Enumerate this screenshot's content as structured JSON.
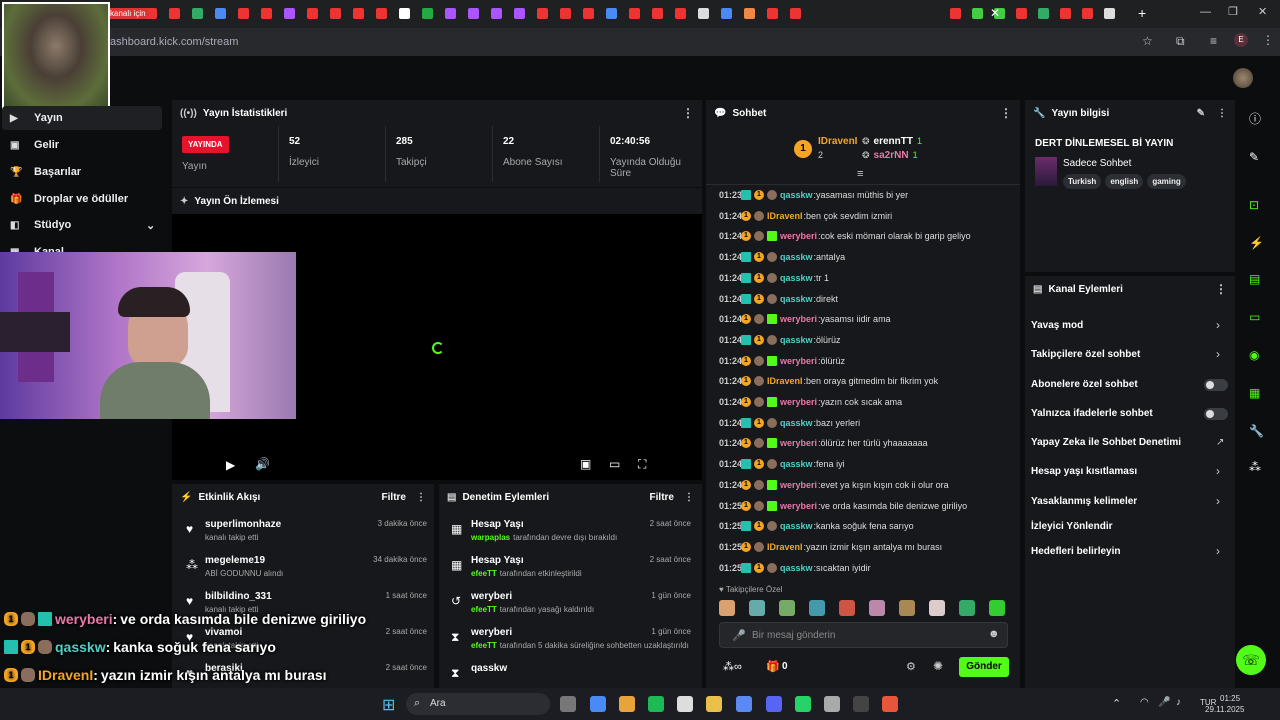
{
  "browser": {
    "url": "ashboard.kick.com/stream",
    "tab_hint": "kanalı için"
  },
  "sidebar": {
    "items": [
      {
        "label": "Yayın",
        "icon": "video-icon"
      },
      {
        "label": "Gelir",
        "icon": "money-icon"
      },
      {
        "label": "Başarılar",
        "icon": "trophy-icon"
      },
      {
        "label": "Droplar ve ödüller",
        "icon": "gift-icon"
      },
      {
        "label": "Stüdyo",
        "icon": "studio-icon"
      },
      {
        "label": "Kanal",
        "icon": "channel-icon"
      }
    ]
  },
  "stats": {
    "title": "Yayın İstatistikleri",
    "live_badge": "YAYINDA",
    "live_label": "Yayın",
    "items": [
      {
        "value": "52",
        "label": "İzleyici"
      },
      {
        "value": "285",
        "label": "Takipçi"
      },
      {
        "value": "22",
        "label": "Abone Sayısı"
      },
      {
        "value": "02:40:56",
        "label": "Yayında Olduğu Süre"
      }
    ]
  },
  "preview": {
    "title": "Yayın Ön İzlemesi"
  },
  "activity": {
    "title": "Etkinlik Akışı",
    "filter": "Filtre",
    "items": [
      {
        "name": "superlimonhaze",
        "sub": "kanalı takip etti",
        "time": "3 dakika önce"
      },
      {
        "name": "megeleme19",
        "sub": "ABİ GODUNNU alındı",
        "time": "34 dakika önce"
      },
      {
        "name": "bilbildino_331",
        "sub": "kanalı takip etti",
        "time": "1 saat önce"
      },
      {
        "name": "vivamoi",
        "sub": "kanalı takip etti",
        "time": "2 saat önce"
      },
      {
        "name": "berasiki",
        "sub": "",
        "time": "2 saat önce"
      }
    ]
  },
  "moderation": {
    "title": "Denetim Eylemleri",
    "filter": "Filtre",
    "items": [
      {
        "name": "Hesap Yaşı",
        "who": "warpaplas",
        "sub": "tarafından devre dışı bırakıldı",
        "time": "2 saat önce"
      },
      {
        "name": "Hesap Yaşı",
        "who": "efeeTT",
        "sub": "tarafından etkinleştirildi",
        "time": "2 saat önce"
      },
      {
        "name": "weryberi",
        "who": "efeeTT",
        "sub": "tarafından yasağı kaldırıldı",
        "time": "1 gün önce"
      },
      {
        "name": "weryberi",
        "who": "efeeTT",
        "sub": "tarafından 5 dakika süreliğine sohbetten uzaklaştırıldı",
        "time": "1 gün önce"
      },
      {
        "name": "qasskw",
        "who": "",
        "sub": "",
        "time": ""
      }
    ]
  },
  "chat": {
    "title": "Sohbet",
    "top": [
      {
        "name": "IDravenI",
        "count": "2",
        "rank": "1"
      },
      {
        "name": "erennTT",
        "count": "1"
      },
      {
        "name": "sa2rNN",
        "count": "1"
      }
    ],
    "messages": [
      {
        "time": "01:23",
        "user": "qasskw",
        "color": "#4fd1c5",
        "text": "yasaması müthis bi yer"
      },
      {
        "time": "01:24",
        "user": "IDravenI",
        "color": "#f5a524",
        "text": "ben çok sevdim izmiri"
      },
      {
        "time": "01:24",
        "user": "weryberi",
        "color": "#e879a8",
        "text": "cok eski mömari olarak bi garip geliyo"
      },
      {
        "time": "01:24",
        "user": "qasskw",
        "color": "#4fd1c5",
        "text": "antalya"
      },
      {
        "time": "01:24",
        "user": "qasskw",
        "color": "#4fd1c5",
        "text": "tr 1"
      },
      {
        "time": "01:24",
        "user": "qasskw",
        "color": "#4fd1c5",
        "text": "direkt"
      },
      {
        "time": "01:24",
        "user": "weryberi",
        "color": "#e879a8",
        "text": "yasamsı iidir ama"
      },
      {
        "time": "01:24",
        "user": "qasskw",
        "color": "#4fd1c5",
        "text": "ölürüz"
      },
      {
        "time": "01:24",
        "user": "weryberi",
        "color": "#e879a8",
        "text": "ölürüz"
      },
      {
        "time": "01:24",
        "user": "IDravenI",
        "color": "#f5a524",
        "text": "ben oraya gitmedim bir fikrim yok"
      },
      {
        "time": "01:24",
        "user": "weryberi",
        "color": "#e879a8",
        "text": "yazın cok sıcak ama"
      },
      {
        "time": "01:24",
        "user": "qasskw",
        "color": "#4fd1c5",
        "text": "bazı yerleri"
      },
      {
        "time": "01:24",
        "user": "weryberi",
        "color": "#e879a8",
        "text": "ölürüz her türlü yhaaaaaaa"
      },
      {
        "time": "01:24",
        "user": "qasskw",
        "color": "#4fd1c5",
        "text": "fena iyi"
      },
      {
        "time": "01:24",
        "user": "weryberi",
        "color": "#e879a8",
        "text": "evet ya kışın kışın cok ii olur ora"
      },
      {
        "time": "01:25",
        "user": "weryberi",
        "color": "#e879a8",
        "text": "ve orda kasımda bile denizwe giriliyo"
      },
      {
        "time": "01:25",
        "user": "qasskw",
        "color": "#4fd1c5",
        "text": "kanka soğuk fena sarıyo"
      },
      {
        "time": "01:25",
        "user": "IDravenI",
        "color": "#f5a524",
        "text": "yazın izmir kışın antalya mı burası"
      },
      {
        "time": "01:25",
        "user": "qasskw",
        "color": "#4fd1c5",
        "text": "sıcaktan iyidir"
      }
    ],
    "followers_only": "Takipçilere Özel",
    "placeholder": "Bir mesaj gönderin",
    "points": "0",
    "send": "Gönder"
  },
  "info": {
    "title": "Yayın bilgisi",
    "stream_title": "DERT DİNLEMESEL Bİ YAYIN",
    "category": "Sadece Sohbet",
    "tags": [
      "Turkish",
      "english",
      "gaming"
    ]
  },
  "actions": {
    "title": "Kanal Eylemleri",
    "items": [
      {
        "label": "Yavaş mod",
        "type": "chevron"
      },
      {
        "label": "Takipçilere özel sohbet",
        "type": "chevron"
      },
      {
        "label": "Abonelere özel sohbet",
        "type": "toggle"
      },
      {
        "label": "Yalnızca ifadelerle sohbet",
        "type": "toggle"
      },
      {
        "label": "Yapay Zeka ile Sohbet Denetimi",
        "type": "external"
      },
      {
        "label": "Hesap yaşı kısıtlaması",
        "type": "chevron"
      },
      {
        "label": "Yasaklanmış kelimeler",
        "type": "chevron"
      },
      {
        "label": "İzleyici Yönlendir",
        "type": "none"
      },
      {
        "label": "Hedefleri belirleyin",
        "type": "chevron"
      }
    ]
  },
  "overlay": [
    {
      "user": "weryberi",
      "color": "#e879a8",
      "text": "ve orda kasımda bile denizwe giriliyo"
    },
    {
      "user": "qasskw",
      "color": "#4fd1c5",
      "text": "kanka soğuk fena sarıyo"
    },
    {
      "user": "IDravenI",
      "color": "#f5a524",
      "text": "yazın izmir kışın antalya mı burası"
    },
    {
      "user": "qasskw",
      "color": "#4fd1c5",
      "text": "sıcaktan iyidir"
    }
  ],
  "taskbar": {
    "search": "Ara",
    "time": "01:25",
    "date": "29.11.2025",
    "lang": "TUR"
  }
}
